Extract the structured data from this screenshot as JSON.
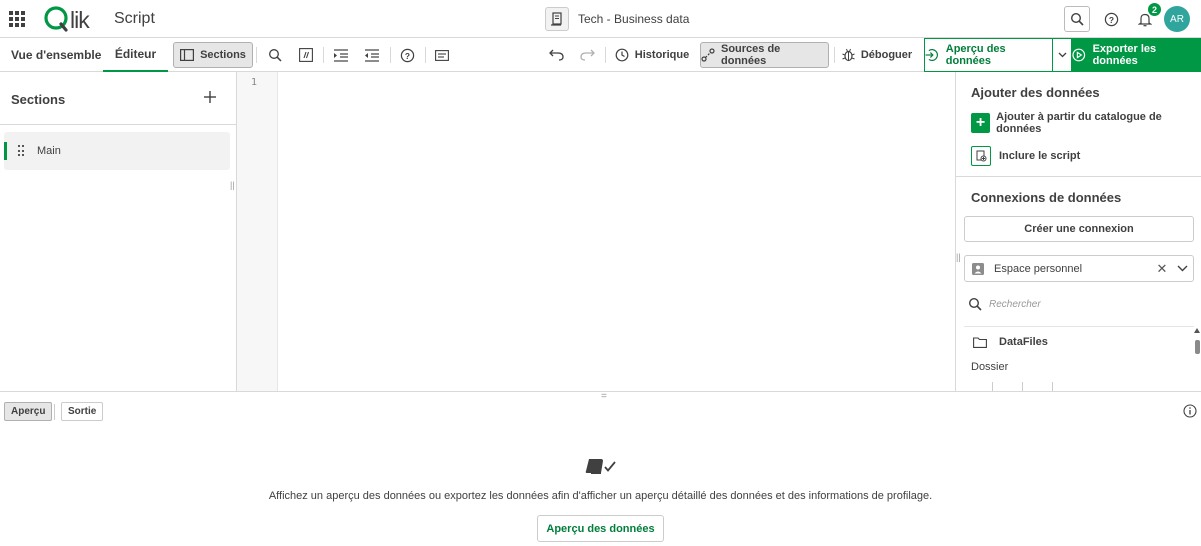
{
  "header": {
    "logo_text": "Qlik",
    "app_section": "Script",
    "app_title": "Tech - Business data",
    "notification_count": "2",
    "avatar_initials": "AR"
  },
  "toolbar": {
    "tab_overview": "Vue d'ensemble",
    "tab_editor": "Éditeur",
    "sections_label": "Sections",
    "history_label": "Historique",
    "sources_label": "Sources de données",
    "debug_label": "Déboguer",
    "preview_label": "Aperçu des données",
    "export_label": "Exporter les données"
  },
  "sections_panel": {
    "title": "Sections",
    "items": [
      {
        "label": "Main"
      }
    ]
  },
  "editor": {
    "line_numbers": [
      "1"
    ]
  },
  "data_panel": {
    "add_title": "Ajouter des données",
    "add_from_catalog": "Ajouter à partir du catalogue de données",
    "include_script": "Inclure le script",
    "connections_title": "Connexions de données",
    "create_connection": "Créer une connexion",
    "space_selected": "Espace personnel",
    "search_placeholder": "Rechercher",
    "folder_name": "DataFiles",
    "folder_type": "Dossier"
  },
  "bottom_panel": {
    "tab_preview": "Aperçu",
    "tab_output": "Sortie",
    "empty_message": "Affichez un aperçu des données ou exportez les données afin d'afficher un aperçu détaillé des données et des informations de profilage.",
    "preview_button": "Aperçu des données"
  },
  "colors": {
    "accent": "#009845",
    "avatar": "#2fa59d"
  }
}
